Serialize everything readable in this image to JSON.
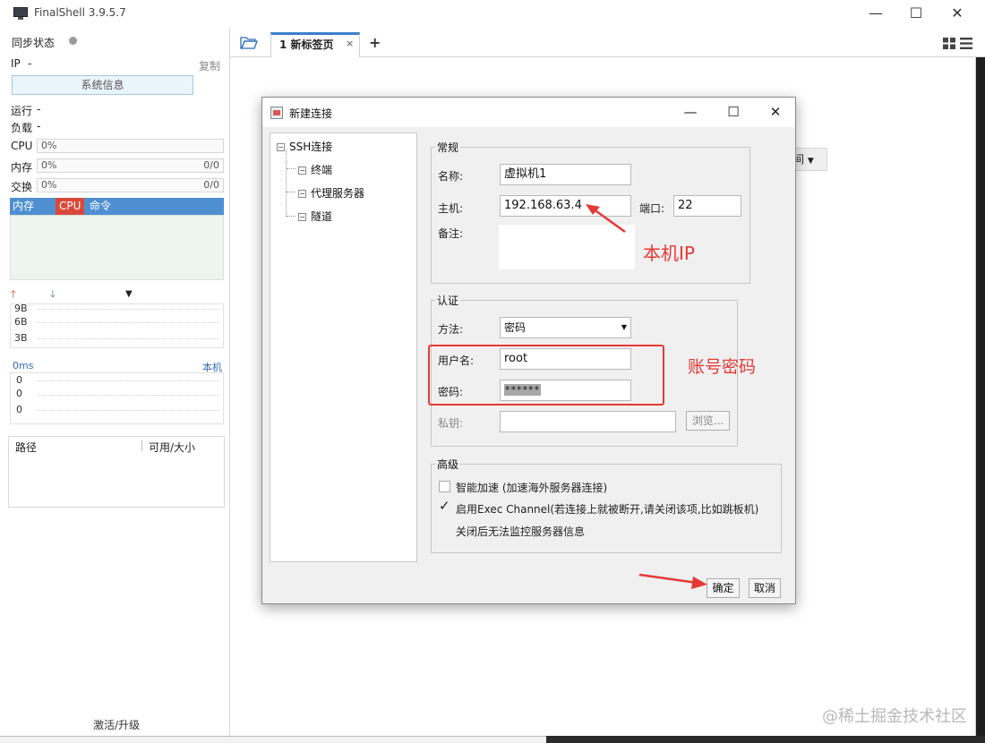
{
  "window": {
    "title": "FinalShell 3.9.5.7",
    "controls": {
      "minimize": "—",
      "maximize": "☐",
      "close": "✕"
    }
  },
  "sidebar": {
    "sync_status": "同步状态",
    "ip_label": "IP",
    "ip_value": "-",
    "copy": "复制",
    "sysinfo_button": "系统信息",
    "running_label": "运行",
    "running_value": "-",
    "load_label": "负载",
    "load_value": "-",
    "cpu_label": "CPU",
    "cpu_value": "0%",
    "mem_label": "内存",
    "mem_value": "0%",
    "mem_right": "0/0",
    "swap_label": "交换",
    "swap_value": "0%",
    "swap_right": "0/0",
    "process_headers": [
      "内存",
      "CPU",
      "命令"
    ],
    "net_ticks": [
      "9B",
      "6B",
      "3B"
    ],
    "ping_label": "0ms",
    "ping_host": "本机",
    "ping_ticks": [
      "0",
      "0",
      "0"
    ],
    "disk_headers": [
      "路径",
      "可用/大小"
    ],
    "activate": "激活/升级"
  },
  "tabs": {
    "items": [
      {
        "label": "1 新标签页",
        "close": "×"
      }
    ],
    "add": "+"
  },
  "background_dropdown": "间",
  "dialog": {
    "title": "新建连接",
    "controls": {
      "minimize": "—",
      "maximize": "☐",
      "close": "✕"
    },
    "tree": {
      "root": "SSH连接",
      "children": [
        "终端",
        "代理服务器",
        "隧道"
      ]
    },
    "general": {
      "legend": "常规",
      "name_label": "名称:",
      "name_value": "虚拟机1",
      "host_label": "主机:",
      "host_value": "192.168.63.4",
      "port_label": "端口:",
      "port_value": "22",
      "note_label": "备注:",
      "note_value": ""
    },
    "auth": {
      "legend": "认证",
      "method_label": "方法:",
      "method_value": "密码",
      "user_label": "用户名:",
      "user_value": "root",
      "password_label": "密码:",
      "password_value": "******",
      "key_label": "私钥:",
      "key_value": "",
      "browse_button": "浏览..."
    },
    "advanced": {
      "legend": "高级",
      "smart_accel": {
        "label": "智能加速 (加速海外服务器连接)",
        "checked": false
      },
      "exec_channel": {
        "label": "启用Exec Channel(若连接上就被断开,请关闭该项,比如跳板机)",
        "checked": true
      },
      "exec_note": "关闭后无法监控服务器信息"
    },
    "ok_button": "确定",
    "cancel_button": "取消"
  },
  "annotations": {
    "local_ip": "本机IP",
    "account_password": "账号密码",
    "color": "#e53935"
  },
  "watermark": "@稀土掘金技术社区"
}
